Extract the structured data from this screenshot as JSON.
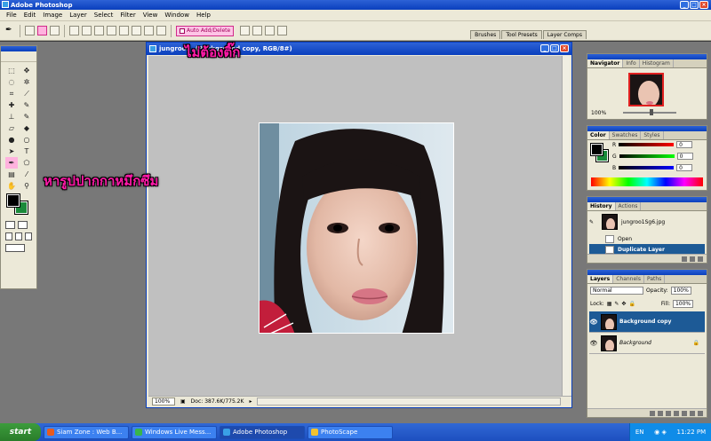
{
  "app": {
    "title": "Adobe Photoshop"
  },
  "menu": [
    "File",
    "Edit",
    "Image",
    "Layer",
    "Select",
    "Filter",
    "View",
    "Window",
    "Help"
  ],
  "options_bar": {
    "auto_add_delete": "Auto Add/Delete",
    "palette_well_tabs": [
      "Brushes",
      "Tool Presets",
      "Layer Comps"
    ]
  },
  "document": {
    "title": "jungroo... (Background copy, RGB/8#)",
    "zoom": "100%",
    "doc_size": "Doc: 387.6K/775.2K"
  },
  "annotations": {
    "top": "ไม่ต้องติ๊ก",
    "left": "หารูปปากกาหมึกซึม"
  },
  "navigator": {
    "tabs": [
      "Navigator",
      "Info",
      "Histogram"
    ],
    "zoom": "100%"
  },
  "color": {
    "tabs": [
      "Color",
      "Swatches",
      "Styles"
    ],
    "channels": [
      {
        "label": "R",
        "value": "0"
      },
      {
        "label": "G",
        "value": "0"
      },
      {
        "label": "B",
        "value": "0"
      }
    ]
  },
  "history": {
    "tabs": [
      "History",
      "Actions"
    ],
    "snapshot": "jungroo1Sg6.jpg",
    "states": [
      {
        "label": "Open",
        "selected": false
      },
      {
        "label": "Duplicate Layer",
        "selected": true
      }
    ]
  },
  "layers": {
    "tabs": [
      "Layers",
      "Channels",
      "Paths"
    ],
    "blend_mode": "Normal",
    "opacity_label": "Opacity:",
    "opacity": "100%",
    "lock_label": "Lock:",
    "fill_label": "Fill:",
    "fill": "100%",
    "items": [
      {
        "name": "Background copy",
        "selected": true
      },
      {
        "name": "Background",
        "selected": false
      }
    ]
  },
  "taskbar": {
    "start": "start",
    "tasks": [
      {
        "label": "Siam Zone : Web B...",
        "active": false
      },
      {
        "label": "Windows Live Mess...",
        "active": false
      },
      {
        "label": "Adobe Photoshop",
        "active": true
      },
      {
        "label": "PhotoScape",
        "active": false
      }
    ],
    "lang": "EN",
    "time": "11:22 PM"
  },
  "colors": {
    "foreground": "#000000",
    "background": "#1a8a3a",
    "annotation": "#ff1aa8",
    "selection": "#1d5a96"
  }
}
